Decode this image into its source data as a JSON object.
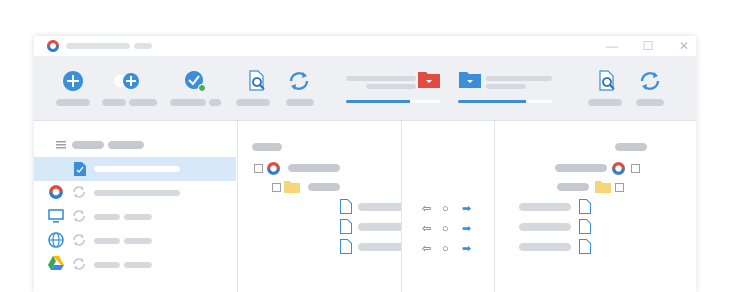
{
  "window": {
    "title": "",
    "controls": {
      "minimize_icon": "—",
      "maximize_icon": "☐",
      "close_icon": "✕"
    }
  },
  "toolbar": {
    "buttons": [
      {
        "name": "add-task-button",
        "icon": "plus-circle-icon",
        "label": ""
      },
      {
        "name": "add-toggle-button",
        "icon": "toggle-plus-icon",
        "label": ""
      },
      {
        "name": "check-status-button",
        "icon": "check-clock-icon",
        "label": ""
      },
      {
        "name": "scan-left-button",
        "icon": "file-search-icon",
        "label": ""
      },
      {
        "name": "sync-left-button",
        "icon": "sync-icon",
        "label": ""
      },
      {
        "name": "scan-right-button",
        "icon": "file-search-icon",
        "label": ""
      },
      {
        "name": "sync-right-button",
        "icon": "sync-icon",
        "label": ""
      }
    ],
    "source_folder": {
      "icon": "red-folder-icon",
      "progress": 0.68,
      "label": ""
    },
    "target_folder": {
      "icon": "blue-folder-icon",
      "progress": 0.72,
      "label": ""
    }
  },
  "sidebar": {
    "header_icon": "list-icon",
    "items": [
      {
        "name": "sidebar-item-document",
        "icon": "document-check-icon",
        "selected": true,
        "label": ""
      },
      {
        "name": "sidebar-item-app",
        "icon": "app-logo-icon",
        "label": ""
      },
      {
        "name": "sidebar-item-computer",
        "icon": "monitor-icon",
        "label": ""
      },
      {
        "name": "sidebar-item-network",
        "icon": "globe-icon",
        "label": ""
      },
      {
        "name": "sidebar-item-drive",
        "icon": "google-drive-icon",
        "label": ""
      }
    ]
  },
  "left_tree": {
    "root": {
      "icon": "app-logo-icon",
      "label": ""
    },
    "folder": {
      "icon": "yellow-folder-icon",
      "label": ""
    },
    "files": [
      "",
      "",
      ""
    ]
  },
  "compare": {
    "rows": [
      {
        "left": "⇦",
        "mid": "○",
        "right": "➡"
      },
      {
        "left": "⇦",
        "mid": "○",
        "right": "➡"
      },
      {
        "left": "⇦",
        "mid": "○",
        "right": "➡"
      }
    ]
  },
  "right_tree": {
    "root": {
      "icon": "app-logo-icon",
      "label": ""
    },
    "folder": {
      "icon": "yellow-folder-icon",
      "label": ""
    },
    "files": [
      "",
      "",
      ""
    ]
  },
  "colors": {
    "accent_blue": "#3a8fd8",
    "brand_red": "#e04b42",
    "folder_yellow": "#f7d57a",
    "selected_row": "#d7e8f8",
    "toolbar_bg": "#eef0f3"
  }
}
